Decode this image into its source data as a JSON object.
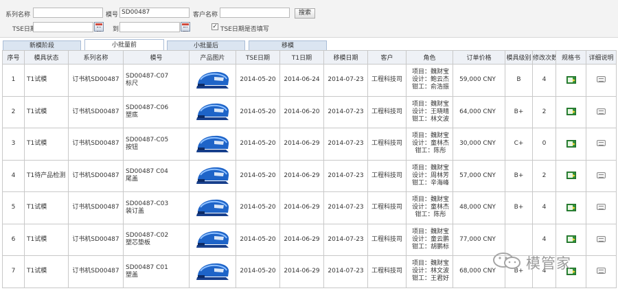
{
  "filter": {
    "series_label": "系列名称",
    "series_value": "",
    "mold_label": "模号",
    "mold_value": "SD00487",
    "customer_label": "客户名称",
    "customer_value": "",
    "search_button": "搜索",
    "tse_label": "TSE日期",
    "tse_value": "",
    "to_label": "到",
    "to_value": "",
    "checkbox_checked": "✓",
    "checkbox_label": "TSE日期是否填写"
  },
  "tabs": [
    "新模阶段",
    "小批量前",
    "小批量后",
    "移模"
  ],
  "table": {
    "headers": [
      "序号",
      "模具状态",
      "系列名称",
      "模号",
      "产品图片",
      "TSE日期",
      "T1日期",
      "移模日期",
      "客户",
      "角色",
      "订单价格",
      "模具级别",
      "修改次数",
      "规格书",
      "详细说明"
    ],
    "rows": [
      {
        "no": "1",
        "status": "T1试模",
        "series": "订书机SD00487",
        "mold_line1": "SD00487-C07",
        "mold_line2": "标尺",
        "tse": "2014-05-20",
        "t1": "2014-06-24",
        "move": "2014-07-23",
        "customer": "工程科技司",
        "role": [
          "项目：魏财宝",
          "设计：鲍云杰",
          "钳工：俞浩振"
        ],
        "price": "59,000 CNY",
        "level": "B",
        "changes": "4"
      },
      {
        "no": "2",
        "status": "T1试模",
        "series": "订书机SD00487",
        "mold_line1": "SD00487-C06",
        "mold_line2": "塑底",
        "tse": "2014-05-20",
        "t1": "2014-06-20",
        "move": "2014-07-23",
        "customer": "工程科技司",
        "role": [
          "项目：魏财宝",
          "设计：王晓晴",
          "钳工：林文波"
        ],
        "price": "64,000 CNY",
        "level": "B+",
        "changes": "2"
      },
      {
        "no": "3",
        "status": "T1试模",
        "series": "订书机SD00487",
        "mold_line1": "SD00487-C05",
        "mold_line2": "按钮",
        "tse": "2014-05-20",
        "t1": "2014-06-29",
        "move": "2014-07-23",
        "customer": "工程科技司",
        "role": [
          "项目：魏财宝",
          "设计：童林杰",
          "钳工：陈彤"
        ],
        "price": "30,000 CNY",
        "level": "C+",
        "changes": "0"
      },
      {
        "no": "4",
        "status": "T1待产品检测",
        "series": "订书机SD00487",
        "mold_line1": "SD00487 C04",
        "mold_line2": "尾盖",
        "tse": "2014-05-20",
        "t1": "2014-06-29",
        "move": "2014-07-23",
        "customer": "工程科技司",
        "role": [
          "项目：魏财宝",
          "设计：周林芳",
          "钳工：辛海峰"
        ],
        "price": "57,000 CNY",
        "level": "B+",
        "changes": "2"
      },
      {
        "no": "5",
        "status": "T1试模",
        "series": "订书机SD00487",
        "mold_line1": "SD00487-C03",
        "mold_line2": "装订盖",
        "tse": "2014-05-20",
        "t1": "2014-06-29",
        "move": "2014-07-23",
        "customer": "工程科技司",
        "role": [
          "项目：魏财宝",
          "设计：童林杰",
          "钳工：陈彤"
        ],
        "price": "48,000 CNY",
        "level": "B+",
        "changes": "4"
      },
      {
        "no": "6",
        "status": "T1试模",
        "series": "订书机SD00487",
        "mold_line1": "SD00487-C02",
        "mold_line2": "塑芯垫板",
        "tse": "2014-05-20",
        "t1": "2014-06-29",
        "move": "2014-07-23",
        "customer": "工程科技司",
        "role": [
          "项目：魏财宝",
          "设计：童云鹏",
          "钳工：胡鹏标"
        ],
        "price": "77,000 CNY",
        "level": "",
        "changes": "4"
      },
      {
        "no": "7",
        "status": "T1试模",
        "series": "订书机SD00487",
        "mold_line1": "SD00487 C01",
        "mold_line2": "塑盖",
        "tse": "2014-05-20",
        "t1": "2014-06-29",
        "move": "2014-07-23",
        "customer": "工程科技司",
        "role": [
          "项目：魏财宝",
          "设计：林文波",
          "钳工：王君好"
        ],
        "price": "68,000 CNY",
        "level": "B+",
        "changes": "4"
      }
    ]
  },
  "icons": {
    "spec": "excel-sheet-icon",
    "detail": "detail-card-icon",
    "photo": "blue-stapler-photo"
  },
  "colors": {
    "tab_active": "#ffffff",
    "tab_inactive": "#dbe5f1",
    "header_bg": "#eef1f6",
    "stapler_blue": "#1e64c8"
  },
  "watermark": {
    "text": "模管家"
  }
}
